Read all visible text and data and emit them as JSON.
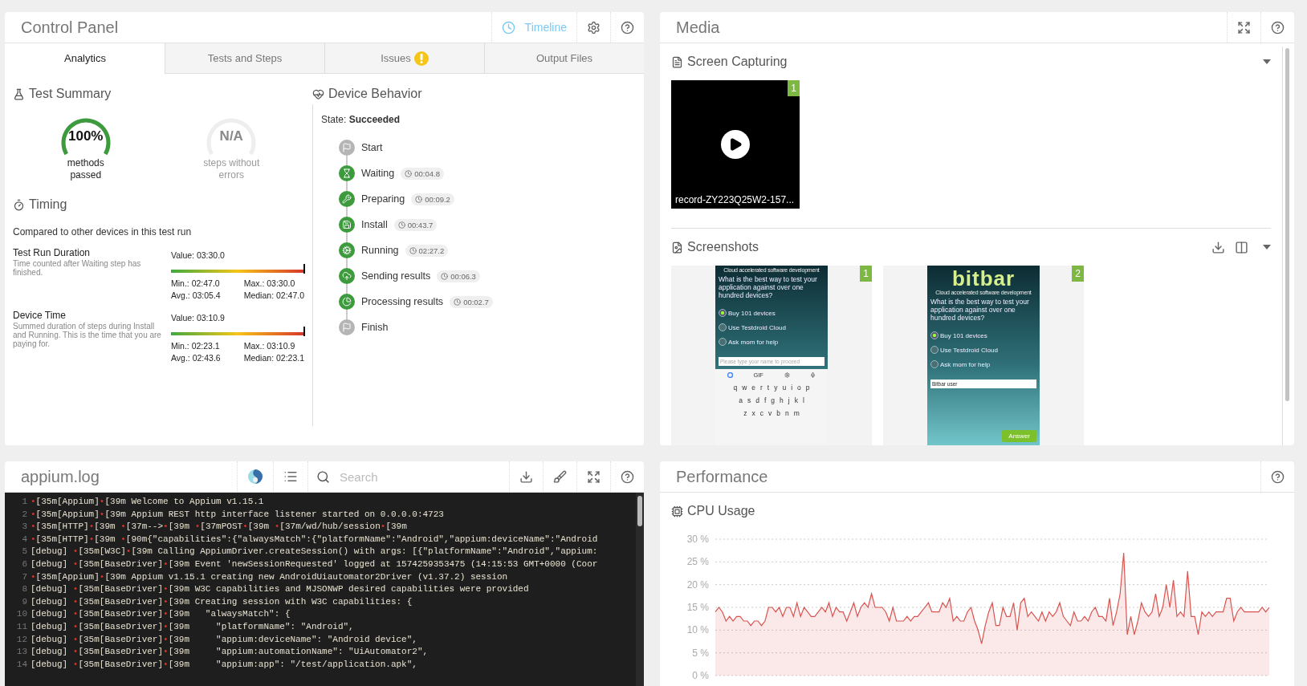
{
  "control_panel": {
    "title": "Control Panel",
    "timeline_label": "Timeline",
    "tabs": [
      {
        "label": "Analytics",
        "selected": true,
        "warning": false
      },
      {
        "label": "Tests and Steps",
        "selected": false,
        "warning": false
      },
      {
        "label": "Issues",
        "selected": false,
        "warning": true
      },
      {
        "label": "Output Files",
        "selected": false,
        "warning": false
      }
    ],
    "test_summary": {
      "title": "Test Summary",
      "gauges": [
        {
          "value": "100%",
          "caption": "methods passed",
          "level": 1
        },
        {
          "value": "N/A",
          "caption": "steps without errors"
        }
      ]
    },
    "timing": {
      "title": "Timing",
      "intro": "Compared to other devices in this test run",
      "metrics": [
        {
          "name": "Test Run Duration",
          "description": "Time counted after Waiting step has finished.",
          "value": "Value: 03:30.0",
          "level": 1,
          "min": "Min.: 02:47.0",
          "max": "Max.: 03:30.0",
          "avg": "Avg.: 03:05.4",
          "median": "Median: 02:47.0"
        },
        {
          "name": "Device Time",
          "description": "Summed duration of steps during Install and Running. This is the time that you are paying for.",
          "value": "Value: 03:10.9",
          "level": 1,
          "min": "Min.: 02:23.1",
          "max": "Max.: 03:10.9",
          "avg": "Avg.: 02:43.6",
          "median": "Median: 02:23.1"
        }
      ]
    },
    "device_behavior": {
      "title": "Device Behavior",
      "state_label": "State:",
      "state": "Succeeded",
      "steps": [
        {
          "label": "Start",
          "kind": "start"
        },
        {
          "label": "Waiting",
          "kind": "waiting",
          "duration": "00:04.8"
        },
        {
          "label": "Preparing",
          "kind": "preparing",
          "duration": "00:09.2"
        },
        {
          "label": "Install",
          "kind": "install",
          "duration": "00:43.7"
        },
        {
          "label": "Running",
          "kind": "running",
          "duration": "02:27.2"
        },
        {
          "label": "Sending results",
          "kind": "sending",
          "duration": "00:06.3"
        },
        {
          "label": "Processing results",
          "kind": "processing",
          "duration": "00:02.7"
        },
        {
          "label": "Finish",
          "kind": "finish"
        }
      ]
    }
  },
  "media": {
    "title": "Media",
    "screen_capturing": {
      "title": "Screen Capturing",
      "videos": [
        {
          "badge": "1",
          "caption": "record-ZY223Q25W2-157..."
        }
      ]
    },
    "screenshots": {
      "title": "Screenshots",
      "items": [
        {
          "badge": "1",
          "phone": {
            "tagline": "Cloud accelerated software development",
            "question": "What is the best way to test your application against over one hundred devices?",
            "options": [
              {
                "label": "Buy 101 devices",
                "selected": true
              },
              {
                "label": "Use Testdroid Cloud",
                "selected": false
              },
              {
                "label": "Ask mom for help",
                "selected": false
              }
            ],
            "input": {
              "placeholder": "Please type your name to proceed"
            },
            "keyboard": {
              "toolbar_label": "GIF",
              "rows": [
                [
                  "q",
                  "w",
                  "e",
                  "r",
                  "t",
                  "y",
                  "u",
                  "i",
                  "o",
                  "p"
                ],
                [
                  "a",
                  "s",
                  "d",
                  "f",
                  "g",
                  "h",
                  "j",
                  "k",
                  "l"
                ],
                [
                  "z",
                  "x",
                  "c",
                  "v",
                  "b",
                  "n",
                  "m"
                ]
              ]
            }
          }
        },
        {
          "badge": "2",
          "phone": {
            "logo": "bitbar",
            "tagline": "Cloud accelerated software development",
            "question": "What is the best way to test your application against over one hundred devices?",
            "options": [
              {
                "label": "Buy 101 devices",
                "selected": true
              },
              {
                "label": "Use Testdroid Cloud",
                "selected": false
              },
              {
                "label": "Ask mom for help",
                "selected": false
              }
            ],
            "input": {
              "value": "Bitbar user"
            },
            "button": "Answer"
          }
        }
      ]
    }
  },
  "log": {
    "title": "appium.log",
    "search_placeholder": "Search",
    "lines": [
      {
        "no": "1",
        "text": "•[35m[Appium]•[39m Welcome to Appium v1.15.1"
      },
      {
        "no": "2",
        "text": "•[35m[Appium]•[39m Appium REST http interface listener started on 0.0.0.0:4723"
      },
      {
        "no": "3",
        "text": "•[35m[HTTP]•[39m •[37m-->•[39m •[37mPOST•[39m •[37m/wd/hub/session•[39m"
      },
      {
        "no": "4",
        "text": "•[35m[HTTP]•[39m •[90m{\"capabilities\":{\"alwaysMatch\":{\"platformName\":\"Android\",\"appium:deviceName\":\"Android"
      },
      {
        "no": "5",
        "text": "[debug] •[35m[W3C]•[39m Calling AppiumDriver.createSession() with args: [{\"platformName\":\"Android\",\"appium:"
      },
      {
        "no": "6",
        "text": "[debug] •[35m[BaseDriver]•[39m Event 'newSessionRequested' logged at 1574259353475 (14:15:53 GMT+0000 (Coor"
      },
      {
        "no": "7",
        "text": "•[35m[Appium]•[39m Appium v1.15.1 creating new AndroidUiautomator2Driver (v1.37.2) session"
      },
      {
        "no": "8",
        "text": "[debug] •[35m[BaseDriver]•[39m W3C capabilities and MJSONWP desired capabilities were provided"
      },
      {
        "no": "9",
        "text": "[debug] •[35m[BaseDriver]•[39m Creating session with W3C capabilities: {"
      },
      {
        "no": "10",
        "text": "[debug] •[35m[BaseDriver]•[39m   \"alwaysMatch\": {"
      },
      {
        "no": "11",
        "text": "[debug] •[35m[BaseDriver]•[39m     \"platformName\": \"Android\","
      },
      {
        "no": "12",
        "text": "[debug] •[35m[BaseDriver]•[39m     \"appium:deviceName\": \"Android device\","
      },
      {
        "no": "13",
        "text": "[debug] •[35m[BaseDriver]•[39m     \"appium:automationName\": \"UiAutomator2\","
      },
      {
        "no": "14",
        "text": "[debug] •[35m[BaseDriver]•[39m     \"appium:app\": \"/test/application.apk\","
      }
    ]
  },
  "performance": {
    "title": "Performance",
    "cpu": {
      "chart_data": {
        "type": "area",
        "title": "CPU Usage",
        "grid": true,
        "ylim": [
          0,
          30
        ],
        "yticks": [
          {
            "value": 0,
            "label": "0 %"
          },
          {
            "value": 5,
            "label": "5 %"
          },
          {
            "value": 10,
            "label": "10 %"
          },
          {
            "value": 15,
            "label": "15 %"
          },
          {
            "value": 20,
            "label": "20 %"
          },
          {
            "value": 25,
            "label": "25 %"
          },
          {
            "value": 30,
            "label": "30 %"
          }
        ],
        "series": [
          {
            "color": "#d9534f",
            "values": [
              14,
              15,
              14,
              12,
              13,
              12,
              13,
              13,
              12,
              12,
              11,
              12,
              12,
              11,
              12,
              15,
              15,
              14,
              15,
              13,
              15,
              15,
              13,
              16,
              13,
              15,
              14,
              13,
              13,
              14,
              15,
              14,
              16,
              13,
              15,
              14,
              14,
              12,
              14,
              16,
              13,
              15,
              16,
              15,
              18,
              15,
              15,
              15,
              14,
              12,
              15,
              12,
              12,
              12,
              13,
              12,
              13,
              13,
              14,
              15,
              16,
              14,
              14,
              14,
              16,
              15,
              17,
              12,
              13,
              12,
              12,
              14,
              15,
              12,
              10,
              7,
              11,
              14,
              16,
              11,
              11,
              15,
              13,
              13,
              16,
              10,
              16,
              17,
              13,
              14,
              13,
              12,
              14,
              12,
              14,
              13,
              14,
              16,
              13,
              12,
              11,
              14,
              12,
              12,
              13,
              12,
              14,
              15,
              13,
              13,
              12,
              17,
              11,
              14,
              18,
              27,
              9,
              13,
              9,
              12,
              16,
              14,
              13,
              14,
              18,
              13,
              15,
              20,
              15,
              21,
              13,
              14,
              13,
              23,
              13,
              13,
              9,
              14,
              13,
              14,
              13,
              14,
              14,
              14,
              17,
              17,
              12,
              14,
              15,
              14,
              14,
              14,
              14,
              14,
              15,
              14,
              15
            ]
          }
        ]
      }
    }
  }
}
